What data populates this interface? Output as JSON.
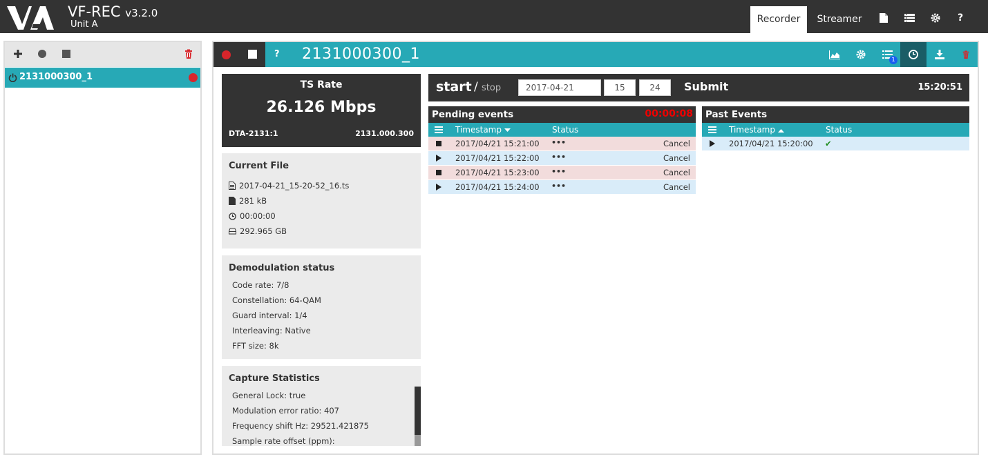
{
  "app": {
    "name": "VF-REC",
    "version": "v3.2.0",
    "unit": "Unit A",
    "nav_tabs": [
      {
        "label": "Recorder",
        "active": true
      },
      {
        "label": "Streamer",
        "active": false
      }
    ],
    "nav_icons": [
      "document-icon",
      "list-view-icon",
      "gear-icon",
      "help-icon"
    ],
    "help_glyph": "?"
  },
  "sidebar": {
    "toolbar_icons": [
      "plus-icon",
      "record-icon",
      "stop-icon",
      "trash-icon"
    ],
    "items": [
      {
        "label": "2131000300_1",
        "recording": true
      }
    ]
  },
  "channel": {
    "title": "2131000300_1",
    "help_glyph": "?",
    "header_icons": [
      "chart-icon",
      "gear-icon",
      "list-icon",
      "clock-icon",
      "download-icon",
      "trash-icon"
    ],
    "list_badge": "1"
  },
  "ts_rate": {
    "title": "TS Rate",
    "value": "26.126 Mbps",
    "device": "DTA-2131:1",
    "frequency": "2131.000.300"
  },
  "current_file": {
    "title": "Current File",
    "filename": "2017-04-21_15-20-52_16.ts",
    "size": "281 kB",
    "duration": "00:00:00",
    "disk_free": "292.965 GB"
  },
  "demodulation": {
    "title": "Demodulation status",
    "lines": [
      "Code rate: 7/8",
      "Constellation: 64-QAM",
      "Guard interval: 1/4",
      "Interleaving: Native",
      "FFT size: 8k"
    ]
  },
  "capture": {
    "title": "Capture Statistics",
    "lines": [
      "General Lock: true",
      "Modulation error ratio: 407",
      "Frequency shift Hz: 29521.421875",
      "Sample rate offset (ppm):"
    ]
  },
  "schedule": {
    "start_label": "start",
    "separator": "/",
    "stop_label": "stop",
    "date": "2017-04-21",
    "hour": "15",
    "minute": "24",
    "submit_label": "Submit",
    "clock": "15:20:51"
  },
  "pending": {
    "title": "Pending events",
    "timer": "00:00:08",
    "columns": {
      "timestamp": "Timestamp",
      "status": "Status"
    },
    "rows": [
      {
        "type": "stop",
        "timestamp": "2017/04/21 15:21:00",
        "status": "•••",
        "action": "Cancel"
      },
      {
        "type": "start",
        "timestamp": "2017/04/21 15:22:00",
        "status": "•••",
        "action": "Cancel"
      },
      {
        "type": "stop",
        "timestamp": "2017/04/21 15:23:00",
        "status": "•••",
        "action": "Cancel"
      },
      {
        "type": "start",
        "timestamp": "2017/04/21 15:24:00",
        "status": "•••",
        "action": "Cancel"
      }
    ]
  },
  "past": {
    "title": "Past Events",
    "columns": {
      "timestamp": "Timestamp",
      "status": "Status"
    },
    "rows": [
      {
        "type": "start",
        "timestamp": "2017/04/21 15:20:00",
        "status": "✔"
      }
    ]
  },
  "colors": {
    "accent": "#27a9b6",
    "dark": "#333333",
    "record": "#d9252b",
    "timer": "#ee0000"
  }
}
